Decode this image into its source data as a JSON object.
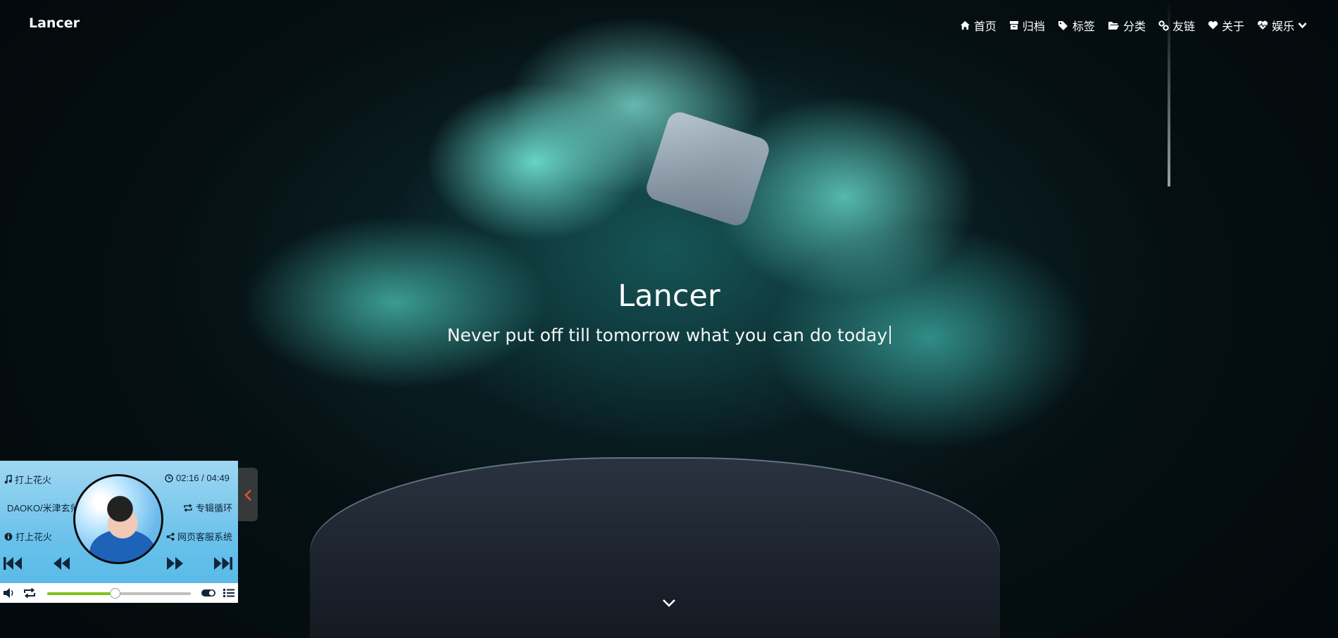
{
  "site": {
    "brand": "Lancer",
    "title": "Lancer",
    "motto": "Never put off till tomorrow what you can do today"
  },
  "nav": {
    "items": [
      {
        "label": "首页",
        "icon": "home-icon"
      },
      {
        "label": "归档",
        "icon": "archive-icon"
      },
      {
        "label": "标签",
        "icon": "tags-icon"
      },
      {
        "label": "分类",
        "icon": "folder-open-icon"
      },
      {
        "label": "友链",
        "icon": "link-icon"
      },
      {
        "label": "关于",
        "icon": "heart-icon"
      },
      {
        "label": "娱乐",
        "icon": "heartbeat-icon"
      }
    ]
  },
  "player": {
    "song": "打上花火",
    "artist": "DAOKO/米津玄师",
    "album": "打上花火",
    "time": "02:16 / 04:49",
    "mode": "专辑循环",
    "share": "网页客服系统",
    "volume": 0.47,
    "accent": "#7fc21a",
    "background": "#66c0ea"
  }
}
